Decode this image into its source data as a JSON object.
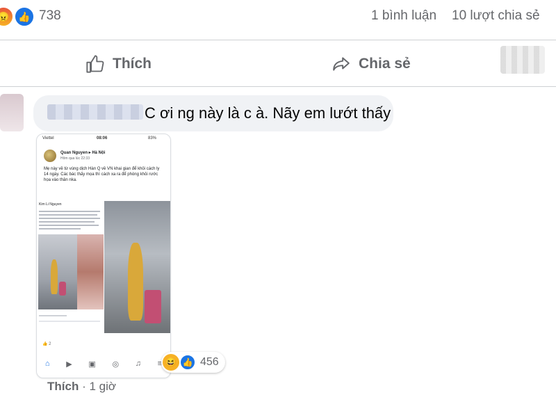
{
  "post_stats": {
    "reaction_icons": [
      "angry",
      "like"
    ],
    "reaction_count": "738",
    "comments": "1 bình luận",
    "shares": "10 lượt chia sẻ"
  },
  "actions": {
    "like": "Thích",
    "share": "Chia sẻ"
  },
  "comment": {
    "text": "C ơi ng này là c à. Nãy em lướt thấy",
    "attachment": {
      "status_time": "08:06",
      "status_carrier": "Viettel",
      "status_battery": "83%",
      "author": "Quan Nguyen ▸ Hà Nội",
      "post_time": "Hôm qua lúc 22:33",
      "post_text": "Mẹ này về từ vùng dịch Hàn Q về VN khai gian để khỏi cách ly 14 ngày. Các bác thấy mọa thì cách xa ra để phòng khỏi rước họa vào thân nka.",
      "inner_author": "Kim Li Nguyen",
      "reactions_count": "2"
    },
    "reactions": {
      "icons": [
        "haha",
        "like"
      ],
      "count": "456"
    },
    "like_label": "Thích",
    "separator": "·",
    "time": "1 giờ"
  },
  "colors": {
    "brand": "#1b74e4",
    "secondary_text": "#65676b",
    "bubble_bg": "#f0f2f5",
    "divider": "#ced0d4"
  }
}
